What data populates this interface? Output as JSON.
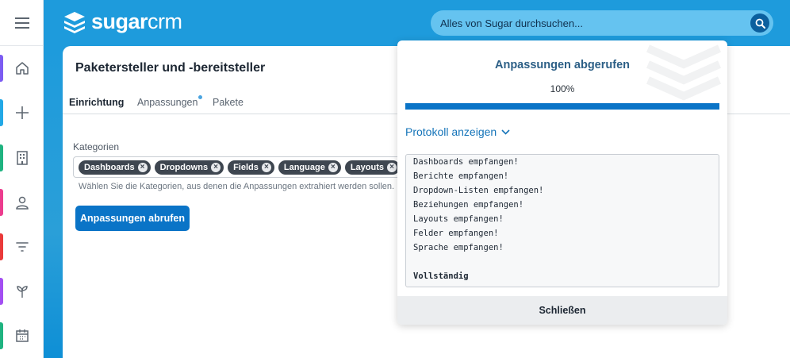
{
  "brand": {
    "name_bold": "sugar",
    "name_light": "crm",
    "header_color": "#1e9bdc",
    "accent": "#0a74c7"
  },
  "search": {
    "placeholder": "Alles von Sugar durchsuchen..."
  },
  "sidebar": {
    "items": [
      {
        "icon": "home-icon",
        "color": "#7c5cf2"
      },
      {
        "icon": "plus-icon",
        "color": "#22a8e6"
      },
      {
        "icon": "building-icon",
        "color": "#1fb380"
      },
      {
        "icon": "user-icon",
        "color": "#ec3c8e"
      },
      {
        "icon": "filter-icon",
        "color": "#ea3a3a"
      },
      {
        "icon": "sprout-icon",
        "color": "#a34ef2"
      },
      {
        "icon": "calendar-icon",
        "color": "#1fb380"
      }
    ]
  },
  "page": {
    "title": "Paketersteller und -bereitsteller",
    "tabs": [
      {
        "label": "Einrichtung",
        "active": true
      },
      {
        "label": "Anpassungen",
        "active": false,
        "dot": true
      },
      {
        "label": "Pakete",
        "active": false
      }
    ],
    "categories_label": "Kategorien",
    "tags": [
      "Dashboards",
      "Dropdowns",
      "Fields",
      "Language",
      "Layouts"
    ],
    "help_text": "Wählen Sie die Kategorien, aus denen die Anpassungen extrahiert werden sollen.",
    "fetch_button": "Anpassungen abrufen"
  },
  "modal": {
    "title": "Anpassungen abgerufen",
    "progress_label": "100%",
    "progress": 1.0,
    "log_toggle": "Protokoll anzeigen",
    "log_lines": [
      "Dashboards empfangen!",
      "Berichte empfangen!",
      "Dropdown-Listen empfangen!",
      "Beziehungen empfangen!",
      "Layouts empfangen!",
      "Felder empfangen!",
      "Sprache empfangen!",
      "",
      "Vollständig"
    ],
    "close_button": "Schließen"
  }
}
